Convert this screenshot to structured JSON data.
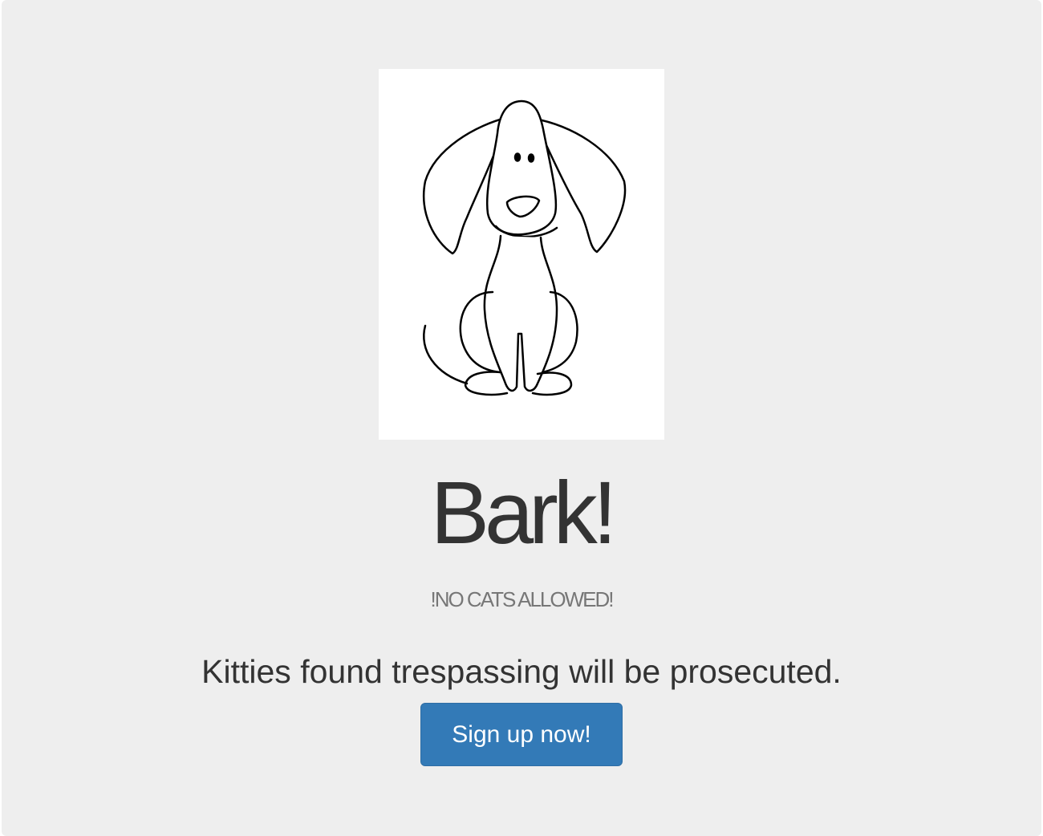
{
  "hero": {
    "image_name": "dog-illustration",
    "title": "Bark!",
    "subtitle": "!NO CATS ALLOWED!",
    "lead": "Kitties found trespassing will be prosecuted.",
    "cta_label": "Sign up now!"
  },
  "colors": {
    "jumbotron_bg": "#eeeeee",
    "button_bg": "#337ab7",
    "button_border": "#2e6da4",
    "button_text": "#ffffff",
    "title_text": "#333333",
    "subtitle_text": "#777777"
  }
}
